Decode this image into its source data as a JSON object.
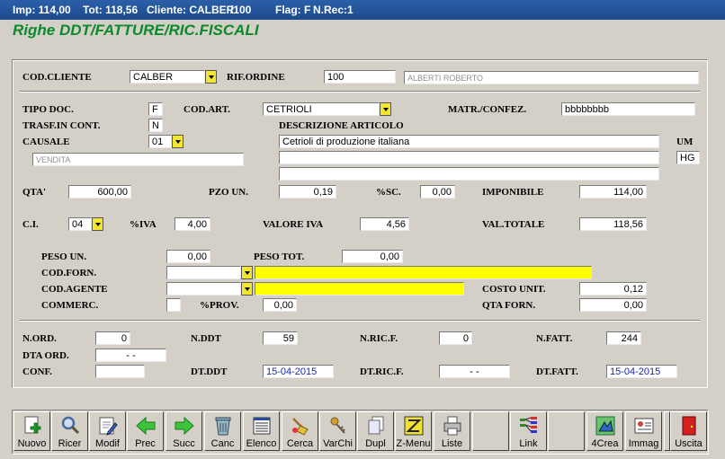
{
  "titlebar": {
    "imp": "Imp: 114,00",
    "tot": "Tot: 118,56",
    "cliente": "Cliente: CALBER",
    "slash": "/100",
    "flag": "Flag: F",
    "nrec": "N.Rec:1"
  },
  "app_title": "Righe DDT/FATTURE/RIC.FISCALI",
  "labels": {
    "cod_cliente": "COD.CLIENTE",
    "rif_ordine": "RIF.ORDINE",
    "tipo_doc": "TIPO DOC.",
    "cod_art": "COD.ART.",
    "matr_confez": "MATR./CONFEZ.",
    "trasf_in_cont": "TRASF.IN CONT.",
    "descrizione_articolo": "DESCRIZIONE ARTICOLO",
    "causale": "CAUSALE",
    "um": "UM",
    "qta": "QTA'",
    "pzo_un": "PZO UN.",
    "sc": "%SC.",
    "imponibile": "IMPONIBILE",
    "ci": "C.I.",
    "iva": "%IVA",
    "valore_iva": "VALORE IVA",
    "val_totale": "VAL.TOTALE",
    "peso_un": "PESO UN.",
    "peso_tot": "PESO TOT.",
    "cod_forn": "COD.FORN.",
    "cod_agente": "COD.AGENTE",
    "costo_unit": "COSTO UNIT.",
    "commerc": "COMMERC.",
    "prov": "%PROV.",
    "qta_forn": "QTA FORN.",
    "n_ord": "N.ORD.",
    "n_ddt": "N.DDT",
    "n_ric_f": "N.RIC.F.",
    "n_fatt": "N.FATT.",
    "dta_ord": "DTA ORD.",
    "conf": "CONF.",
    "dt_ddt": "DT.DDT",
    "dt_ric_f": "DT.RIC.F.",
    "dt_fatt": "DT.FATT."
  },
  "values": {
    "cod_cliente": "CALBER",
    "rif_ordine": "100",
    "cliente_nome": "ALBERTI ROBERTO",
    "tipo_doc": "F",
    "cod_art": "CETRIOLI",
    "matr_confez": "bbbbbbbb",
    "trasf_in_cont": "N",
    "causale": "01",
    "causale_desc": "VENDITA",
    "descrizione1": "Cetrioli di produzione italiana",
    "descrizione2": "",
    "descrizione3": "",
    "um": "HG",
    "qta": "600,00",
    "pzo_un": "0,19",
    "sc": "0,00",
    "imponibile": "114,00",
    "ci": "04",
    "iva": "4,00",
    "valore_iva": "4,56",
    "val_totale": "118,56",
    "peso_un": "0,00",
    "peso_tot": "0,00",
    "cod_forn": "",
    "cod_forn_desc": "",
    "cod_agente": "",
    "cod_agente_desc": "",
    "costo_unit": "0,12",
    "commerc": "",
    "prov": "0,00",
    "qta_forn": "0,00",
    "n_ord": "0",
    "n_ddt": "59",
    "n_ric_f": "0",
    "n_fatt": "244",
    "dta_ord": "-   -",
    "conf": "",
    "dt_ddt": "15-04-2015",
    "dt_ric_f": "-   -",
    "dt_fatt": "15-04-2015"
  },
  "toolbar": [
    {
      "label": "Nuovo",
      "icon": "new-document-icon"
    },
    {
      "label": "Ricer",
      "icon": "magnifier-icon"
    },
    {
      "label": "Modif",
      "icon": "edit-document-icon"
    },
    {
      "label": "Prec",
      "icon": "arrow-left-icon"
    },
    {
      "label": "Succ",
      "icon": "arrow-right-icon"
    },
    {
      "label": "Canc",
      "icon": "trash-icon"
    },
    {
      "label": "Elenco",
      "icon": "list-icon"
    },
    {
      "label": "Cerca",
      "icon": "broom-icon"
    },
    {
      "label": "VarChi",
      "icon": "keys-icon"
    },
    {
      "label": "Dupl",
      "icon": "duplicate-icon"
    },
    {
      "label": "Z-Menu",
      "icon": "menu-icon"
    },
    {
      "label": "Liste",
      "icon": "printer-icon"
    },
    {
      "label": "",
      "icon": ""
    },
    {
      "label": "Link",
      "icon": "link-icon"
    },
    {
      "label": "",
      "icon": ""
    },
    {
      "label": "4Crea",
      "icon": "create-icon"
    },
    {
      "label": "Immag",
      "icon": "image-card-icon"
    },
    {
      "label": "",
      "icon": ""
    },
    {
      "label": "Uscita",
      "icon": "exit-door-icon"
    }
  ],
  "colors": {
    "title_green": "#0a8a2a",
    "field_blue": "#1a2aa8",
    "highlight_yellow": "#ffff00"
  }
}
